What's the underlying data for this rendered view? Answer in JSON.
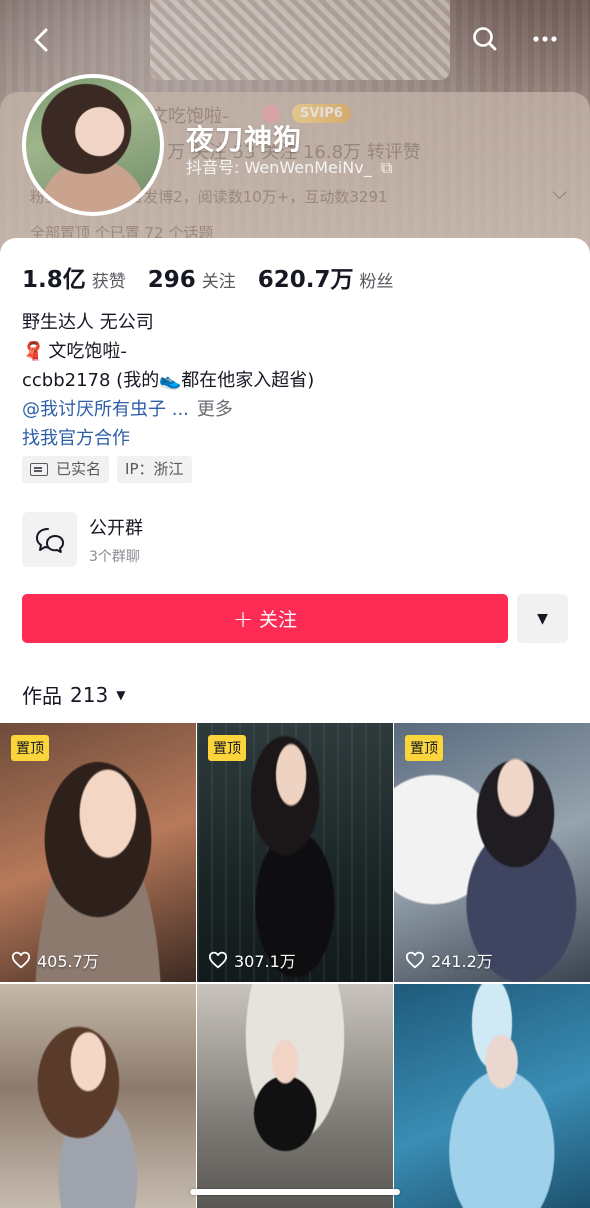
{
  "header": {
    "nickname": "夜刀神狗",
    "douyin_id": "抖音号: WenWenMeiNv_",
    "ghost_name": "文吃饱啦-",
    "ghost_badge": "SVIP6",
    "ghost_stats": "9 万 关注     53 关注     16.8万 转评赞",
    "ghost_line2": "粉丝 124名     昨日发博2，阅读数10万+，互动数3291",
    "ghost_line3": "全部置顶   个已置 72 个话题"
  },
  "stats": [
    {
      "num": "1.8亿",
      "label": "获赞"
    },
    {
      "num": "296",
      "label": "关注"
    },
    {
      "num": "620.7万",
      "label": "粉丝"
    }
  ],
  "bio": {
    "line1": "野生达人 无公司",
    "line2_icon": "🧣",
    "line2": "文吃饱啦-",
    "line3_a": "ccbb2178 (我的",
    "line3_icon": "👟",
    "line3_b": "都在他家入超省)",
    "mention": "@我讨厌所有虫子 ...",
    "more": "更多",
    "biz_link": "找我官方合作"
  },
  "tags": [
    {
      "label": "已实名",
      "icon": "id-card-icon"
    },
    {
      "label": "IP：浙江"
    }
  ],
  "group": {
    "title": "公开群",
    "subtitle": "3个群聊"
  },
  "follow": {
    "plus": "+",
    "label": "关注"
  },
  "works": {
    "label": "作品",
    "count": "213"
  },
  "grid": [
    {
      "pinned": "置顶",
      "likes": "405.7万"
    },
    {
      "pinned": "置顶",
      "likes": "307.1万"
    },
    {
      "pinned": "置顶",
      "likes": "241.2万"
    },
    {
      "pinned": "",
      "likes": ""
    },
    {
      "pinned": "",
      "likes": ""
    },
    {
      "pinned": "",
      "likes": ""
    }
  ],
  "colors": {
    "accent": "#fe2c55",
    "link": "#2c5fa8",
    "pin": "#fbd53b"
  }
}
